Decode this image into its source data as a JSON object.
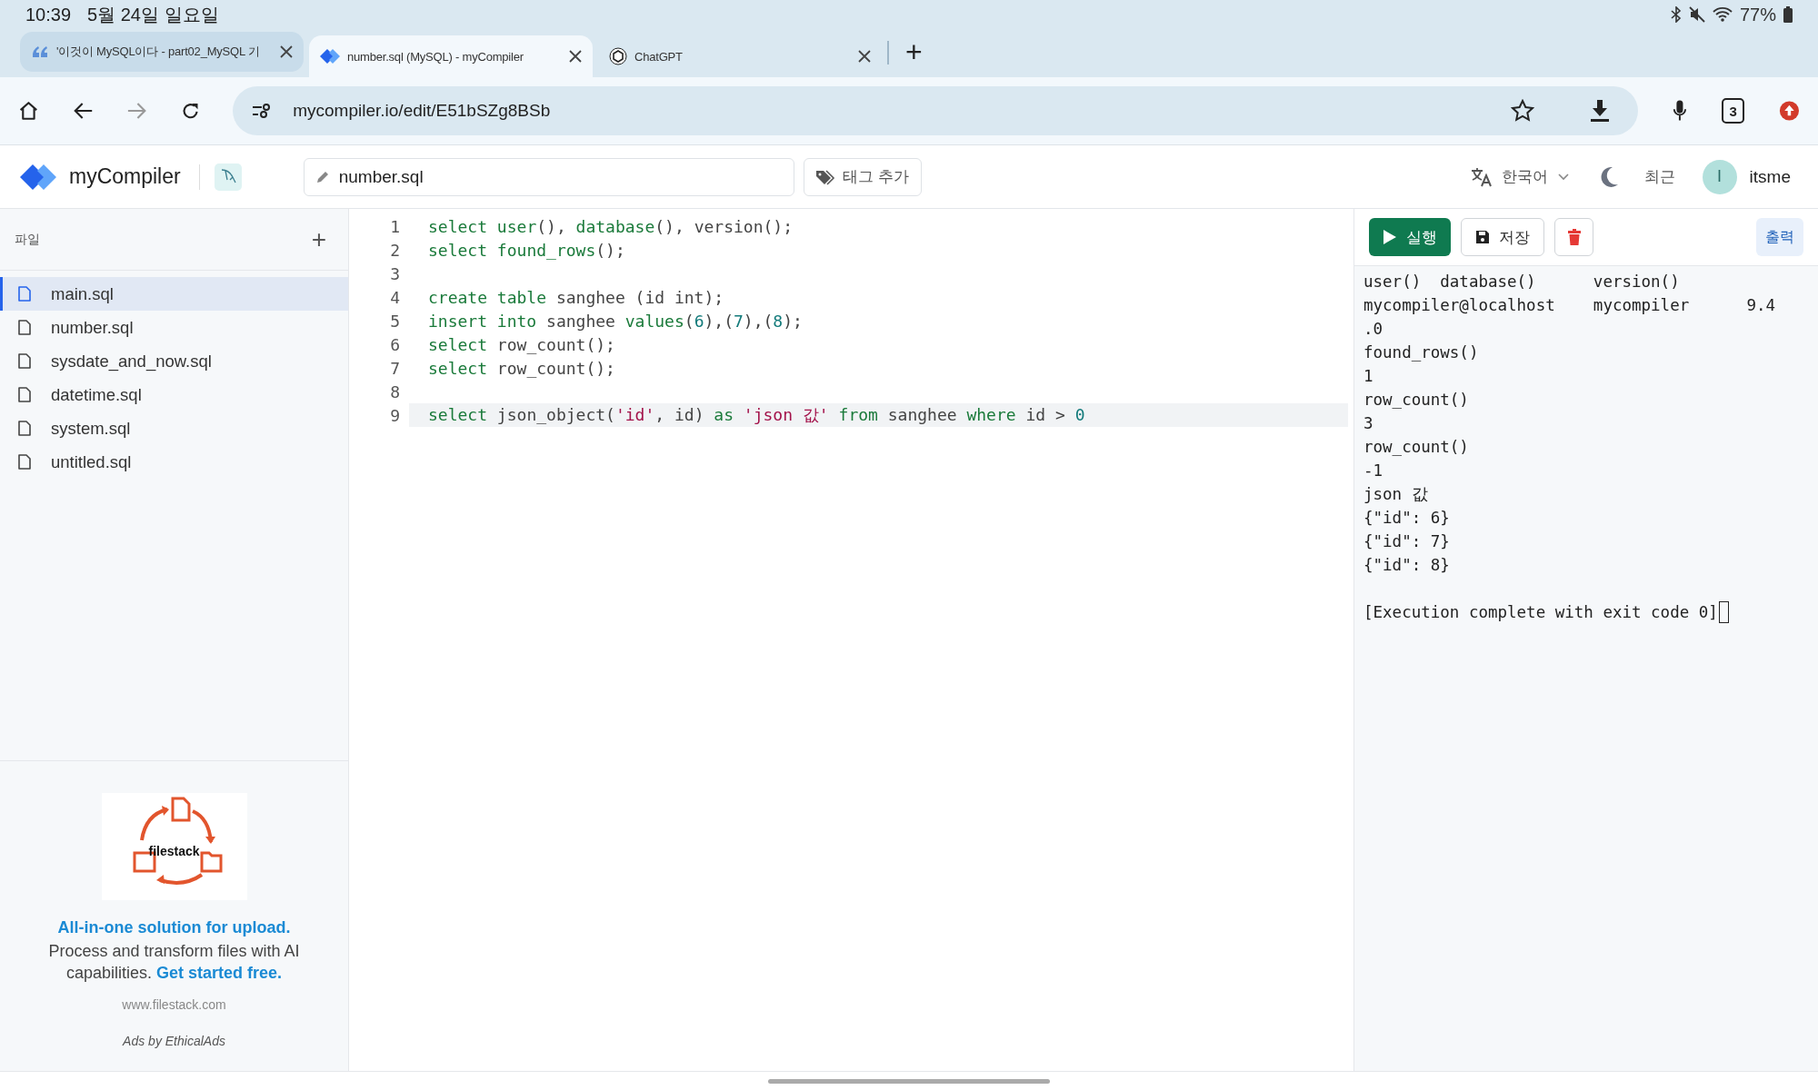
{
  "status_bar": {
    "time": "10:39",
    "date": "5월 24일 일요일",
    "battery": "77%"
  },
  "browser": {
    "tabs": [
      {
        "title": "'이것이 MySQL이다 - part02_MySQL 기",
        "selected": false
      },
      {
        "title": "number.sql (MySQL) - myCompiler",
        "selected": true
      },
      {
        "title": "ChatGPT",
        "selected": false
      }
    ],
    "new_tab": "+",
    "url": "mycompiler.io/edit/E51bSZg8BSb",
    "tab_count": "3"
  },
  "app": {
    "brand": "myCompiler",
    "file_name": "number.sql",
    "tag_button": "태그 추가",
    "language": "한국어",
    "recent": "최근",
    "avatar": "I",
    "user": "itsme"
  },
  "sidebar": {
    "title": "파일",
    "add": "+",
    "files": [
      {
        "name": "main.sql",
        "selected": true
      },
      {
        "name": "number.sql",
        "selected": false
      },
      {
        "name": "sysdate_and_now.sql",
        "selected": false
      },
      {
        "name": "datetime.sql",
        "selected": false
      },
      {
        "name": "system.sql",
        "selected": false
      },
      {
        "name": "untitled.sql",
        "selected": false
      }
    ]
  },
  "ad": {
    "image_text": "filestack",
    "headline": "All-in-one solution for upload.",
    "body": "Process and transform files with AI capabilities.",
    "link": "Get started free.",
    "domain": "www.filestack.com",
    "credit": "Ads by EthicalAds"
  },
  "editor": {
    "lines": [
      {
        "number": "1",
        "active": false,
        "tokens": [
          {
            "text": "select",
            "kind": "keyword"
          },
          {
            "text": " user",
            "kind": "keyword"
          },
          {
            "text": "(), ",
            "kind": "plain"
          },
          {
            "text": "database",
            "kind": "keyword"
          },
          {
            "text": "(), version();",
            "kind": "plain"
          }
        ]
      },
      {
        "number": "2",
        "active": false,
        "tokens": [
          {
            "text": "select",
            "kind": "keyword"
          },
          {
            "text": " found_rows",
            "kind": "keyword"
          },
          {
            "text": "();",
            "kind": "plain"
          }
        ]
      },
      {
        "number": "3",
        "active": false
      },
      {
        "number": "4",
        "active": false,
        "tokens": [
          {
            "text": "create table",
            "kind": "keyword"
          },
          {
            "text": " sanghee (id int);",
            "kind": "plain"
          }
        ]
      },
      {
        "number": "5",
        "active": false,
        "tokens": [
          {
            "text": "insert into",
            "kind": "keyword"
          },
          {
            "text": " sanghee ",
            "kind": "plain"
          },
          {
            "text": "values",
            "kind": "keyword"
          },
          {
            "text": "(",
            "kind": "plain"
          },
          {
            "text": "6",
            "kind": "number"
          },
          {
            "text": "),(",
            "kind": "plain"
          },
          {
            "text": "7",
            "kind": "number"
          },
          {
            "text": "),(",
            "kind": "plain"
          },
          {
            "text": "8",
            "kind": "number"
          },
          {
            "text": ");",
            "kind": "plain"
          }
        ]
      },
      {
        "number": "6",
        "active": false,
        "tokens": [
          {
            "text": "select",
            "kind": "keyword"
          },
          {
            "text": " row_count();",
            "kind": "plain"
          }
        ]
      },
      {
        "number": "7",
        "active": false,
        "tokens": [
          {
            "text": "select",
            "kind": "keyword"
          },
          {
            "text": " row_count();",
            "kind": "plain"
          }
        ]
      },
      {
        "number": "8",
        "active": false
      },
      {
        "number": "9",
        "active": true,
        "tokens": [
          {
            "text": "select",
            "kind": "keyword"
          },
          {
            "text": " json_object(",
            "kind": "plain"
          },
          {
            "text": "'id'",
            "kind": "string"
          },
          {
            "text": ", id) ",
            "kind": "plain"
          },
          {
            "text": "as",
            "kind": "keyword"
          },
          {
            "text": " 'json 값'",
            "kind": "string"
          },
          {
            "text": " from",
            "kind": "keyword"
          },
          {
            "text": " sanghee ",
            "kind": "plain"
          },
          {
            "text": "where",
            "kind": "keyword"
          },
          {
            "text": " id > ",
            "kind": "plain"
          },
          {
            "text": "0",
            "kind": "number"
          }
        ]
      }
    ]
  },
  "output": {
    "run": "실행",
    "save": "저장",
    "tab": "출력",
    "lines": [
      "user()  database()      version()",
      "mycompiler@localhost    mycompiler      9.4",
      ".0",
      "found_rows()",
      "1",
      "row_count()",
      "3",
      "row_count()",
      "-1",
      "json 값",
      "{\"id\": 6}",
      "{\"id\": 7}",
      "{\"id\": 8}"
    ],
    "status_line": "[Execution complete with exit code 0]"
  }
}
